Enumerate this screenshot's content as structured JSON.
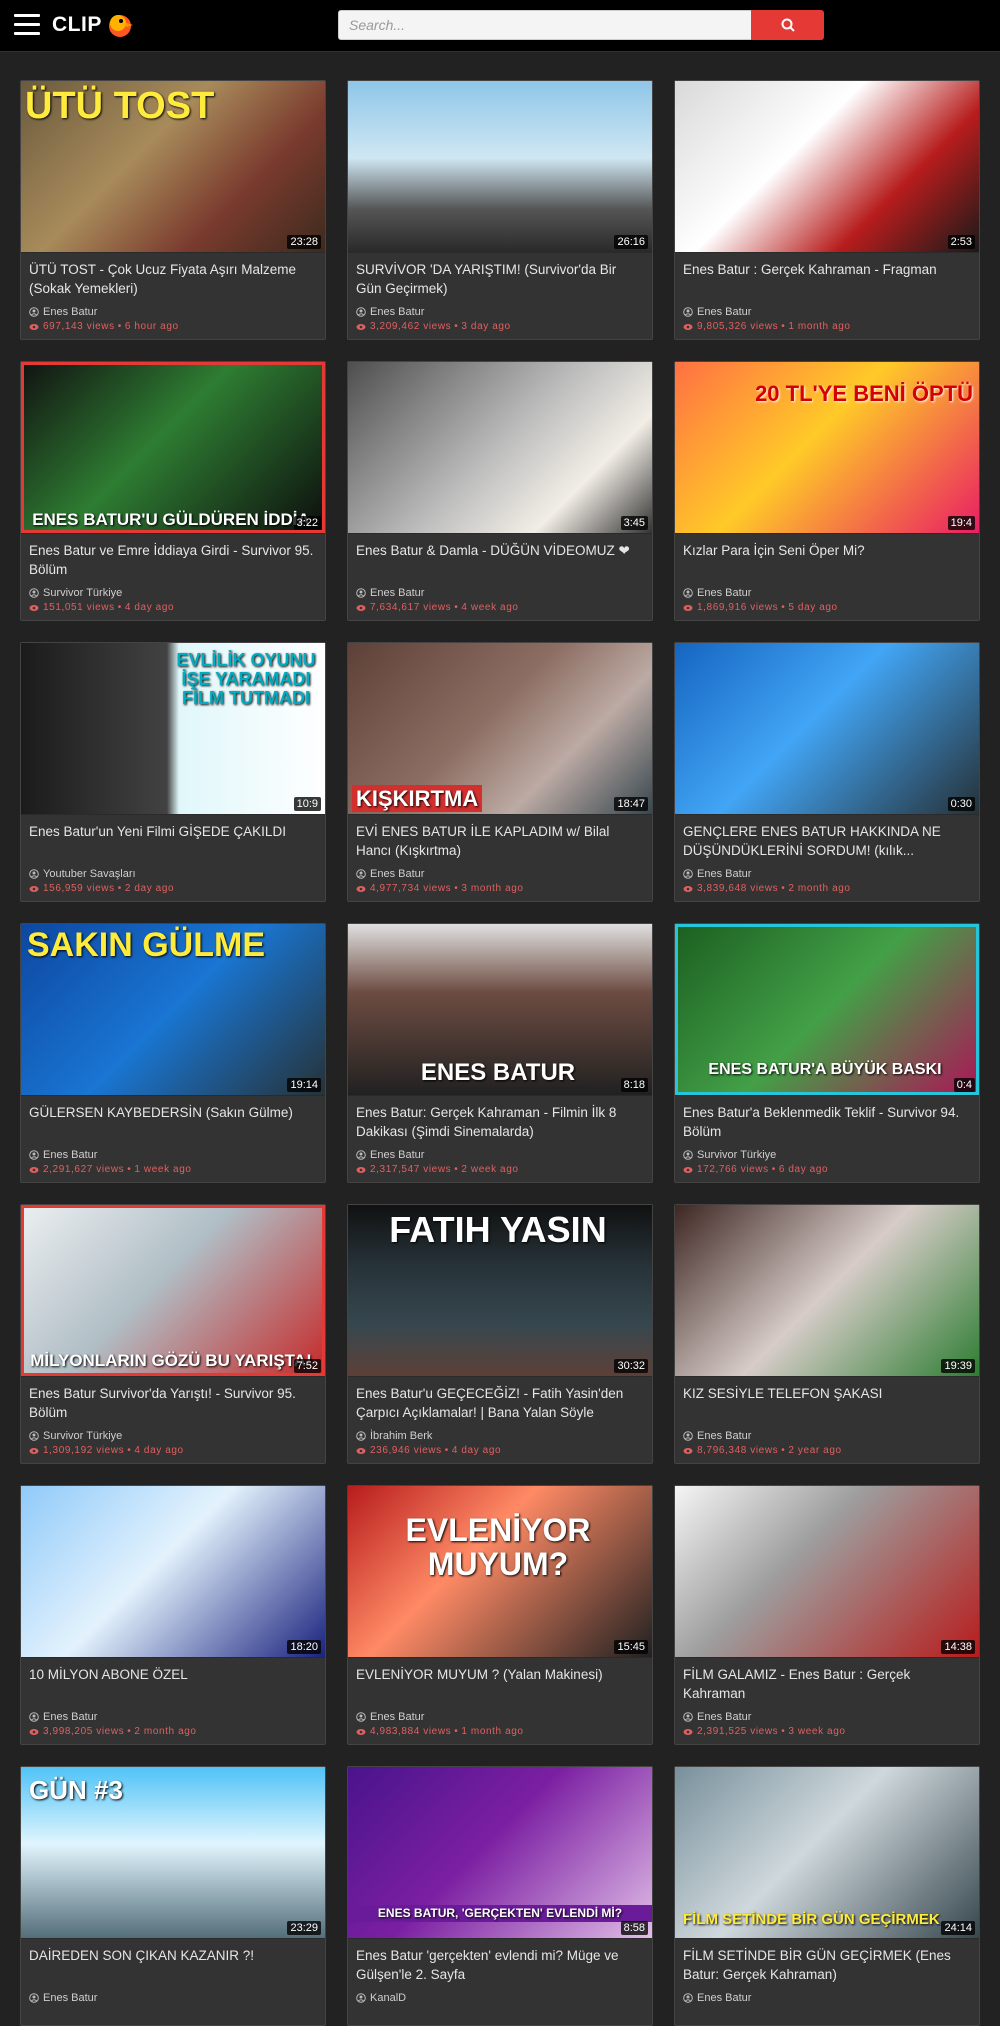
{
  "header": {
    "logo_text": "CLIP",
    "search_placeholder": "Search...",
    "search_value": ""
  },
  "colors": {
    "accent": "#e53935",
    "background": "#222222",
    "card": "#333333",
    "meta": "#e06060"
  },
  "videos": [
    {
      "title": "ÜTÜ TOST - Çok Ucuz Fiyata Aşırı Malzeme (Sokak Yemekleri)",
      "channel": "Enes Batur",
      "views": "697,143 views",
      "ago": "6 hour ago",
      "duration": "23:28",
      "overlay": "ÜTÜ TOST"
    },
    {
      "title": "SURVİVOR 'DA YARIŞTIM! (Survivor'da Bir Gün Geçirmek)",
      "channel": "Enes Batur",
      "views": "3,209,462 views",
      "ago": "3 day ago",
      "duration": "26:16",
      "overlay": ""
    },
    {
      "title": "Enes Batur : Gerçek Kahraman - Fragman",
      "channel": "Enes Batur",
      "views": "9,805,326 views",
      "ago": "1 month ago",
      "duration": "2:53",
      "overlay": ""
    },
    {
      "title": "Enes Batur ve Emre İddiaya Girdi - Survivor 95. Bölüm",
      "channel": "Survivor Türkiye",
      "views": "151,051 views",
      "ago": "4 day ago",
      "duration": "3:22",
      "overlay": "ENES BATUR'U GÜLDÜREN İDDİA"
    },
    {
      "title": "Enes Batur & Damla - DÜĞÜN VİDEOMUZ ❤",
      "channel": "Enes Batur",
      "views": "7,634,617 views",
      "ago": "4 week ago",
      "duration": "3:45",
      "overlay": ""
    },
    {
      "title": "Kızlar Para İçin Seni Öper Mi?",
      "channel": "Enes Batur",
      "views": "1,869,916 views",
      "ago": "5 day ago",
      "duration": "19:4",
      "overlay": "20 TL'YE BENİ ÖPTÜ"
    },
    {
      "title": "Enes Batur'un Yeni Filmi GİŞEDE ÇAKILDI",
      "channel": "Youtuber Savaşları",
      "views": "156,959 views",
      "ago": "2 day ago",
      "duration": "10:9",
      "overlay": "EVLİLİK OYUNU İŞE YARAMADI FİLM TUTMADI"
    },
    {
      "title": "EVİ ENES BATUR İLE KAPLADIM w/ Bilal Hancı (Kışkırtma)",
      "channel": "Enes Batur",
      "views": "4,977,734 views",
      "ago": "3 month ago",
      "duration": "18:47",
      "overlay": "KIŞKIRTMA"
    },
    {
      "title": "GENÇLERE ENES BATUR HAKKINDA NE DÜŞÜNDÜKLERİNİ SORDUM! (kılık...",
      "channel": "Enes Batur",
      "views": "3,839,648 views",
      "ago": "2 month ago",
      "duration": "0:30",
      "overlay": ""
    },
    {
      "title": "GÜLERSEN KAYBEDERSİN (Sakın Gülme)",
      "channel": "Enes Batur",
      "views": "2,291,627 views",
      "ago": "1 week ago",
      "duration": "19:14",
      "overlay": "SAKIN GÜLME"
    },
    {
      "title": "Enes Batur: Gerçek Kahraman - Filmin İlk 8 Dakikası (Şimdi Sinemalarda)",
      "channel": "Enes Batur",
      "views": "2,317,547 views",
      "ago": "2 week ago",
      "duration": "8:18",
      "overlay": "ENES BATUR"
    },
    {
      "title": "Enes Batur'a Beklenmedik Teklif - Survivor 94. Bölüm",
      "channel": "Survivor Türkiye",
      "views": "172,766 views",
      "ago": "6 day ago",
      "duration": "0:4",
      "overlay": "ENES BATUR'A BÜYÜK BASKI"
    },
    {
      "title": "Enes Batur Survivor'da Yarıştı! - Survivor 95. Bölüm",
      "channel": "Survivor Türkiye",
      "views": "1,309,192 views",
      "ago": "4 day ago",
      "duration": "7:52",
      "overlay": "MİLYONLARIN GÖZÜ BU YARIŞTA!"
    },
    {
      "title": "Enes Batur'u GEÇECEĞİZ! - Fatih Yasin'den Çarpıcı Açıklamalar! | Bana Yalan Söyle",
      "channel": "İbrahim Berk",
      "views": "236,946 views",
      "ago": "4 day ago",
      "duration": "30:32",
      "overlay": "FATIH YASIN"
    },
    {
      "title": "KIZ SESİYLE TELEFON ŞAKASI",
      "channel": "Enes Batur",
      "views": "8,796,348 views",
      "ago": "2 year ago",
      "duration": "19:39",
      "overlay": ""
    },
    {
      "title": "10 MİLYON ABONE ÖZEL",
      "channel": "Enes Batur",
      "views": "3,998,205 views",
      "ago": "2 month ago",
      "duration": "18:20",
      "overlay": ""
    },
    {
      "title": "EVLENİYOR MUYUM ? (Yalan Makinesi)",
      "channel": "Enes Batur",
      "views": "4,983,884 views",
      "ago": "1 month ago",
      "duration": "15:45",
      "overlay": "EVLENİYOR MUYUM?"
    },
    {
      "title": "FİLM GALAMIZ - Enes Batur : Gerçek Kahraman",
      "channel": "Enes Batur",
      "views": "2,391,525 views",
      "ago": "3 week ago",
      "duration": "14:38",
      "overlay": ""
    },
    {
      "title": "DAİREDEN SON ÇIKAN KAZANIR ?!",
      "channel": "Enes Batur",
      "views": "",
      "ago": "",
      "duration": "23:29",
      "overlay": "GÜN #3"
    },
    {
      "title": "Enes Batur 'gerçekten' evlendi mi? Müge ve Gülşen'le 2. Sayfa",
      "channel": "KanalD",
      "views": "",
      "ago": "",
      "duration": "8:58",
      "overlay": "ENES BATUR, 'GERÇEKTEN' EVLENDİ Mİ?"
    },
    {
      "title": "FİLM SETİNDE BİR GÜN GEÇİRMEK (Enes Batur: Gerçek Kahraman)",
      "channel": "Enes Batur",
      "views": "",
      "ago": "",
      "duration": "24:14",
      "overlay": "FİLM SETİNDE BİR GÜN GEÇİRMEK"
    }
  ]
}
